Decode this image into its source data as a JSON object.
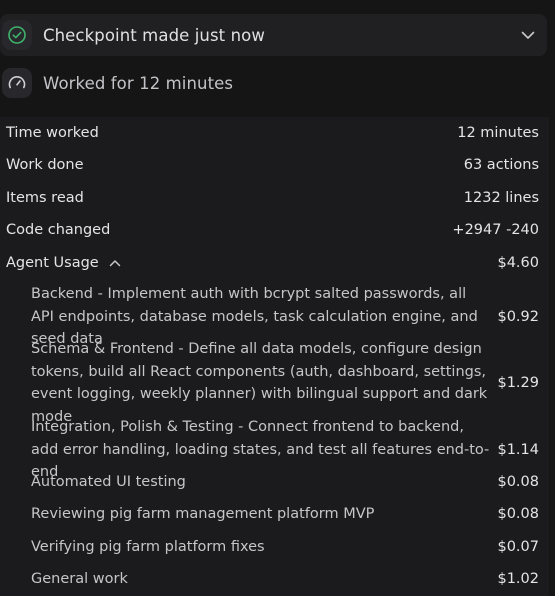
{
  "checkpoint": {
    "label": "Checkpoint made just now"
  },
  "worked": {
    "label": "Worked for 12 minutes"
  },
  "stats": [
    {
      "label": "Time worked",
      "value": "12 minutes"
    },
    {
      "label": "Work done",
      "value": "63 actions"
    },
    {
      "label": "Items read",
      "value": "1232 lines"
    },
    {
      "label": "Code changed",
      "value": "+2947 -240"
    }
  ],
  "agent_usage": {
    "label": "Agent Usage",
    "total": "$4.60",
    "items": [
      {
        "desc": "Backend - Implement auth with bcrypt salted passwords, all API endpoints, database models, task calculation engine, and seed data",
        "cost": "$0.92"
      },
      {
        "desc": "Schema & Frontend - Define all data models, configure design tokens, build all React components (auth, dashboard, settings, event logging, weekly planner) with bilingual support and dark mode",
        "cost": "$1.29"
      },
      {
        "desc": "Integration, Polish & Testing - Connect frontend to backend, add error handling, loading states, and test all features end-to-end",
        "cost": "$1.14"
      },
      {
        "desc": "Automated UI testing",
        "cost": "$0.08"
      },
      {
        "desc": "Reviewing pig farm management platform MVP",
        "cost": "$0.08"
      },
      {
        "desc": "Verifying pig farm platform fixes",
        "cost": "$0.07"
      },
      {
        "desc": "General work",
        "cost": "$1.02"
      }
    ]
  },
  "colors": {
    "background": "#151516",
    "panel": "#1b1b1d",
    "success": "#3fb36b"
  },
  "icons": {
    "checkpoint": "check-circle-icon",
    "worked": "speedometer-icon",
    "expand": "chevron-down-icon",
    "collapse": "chevron-up-icon"
  }
}
